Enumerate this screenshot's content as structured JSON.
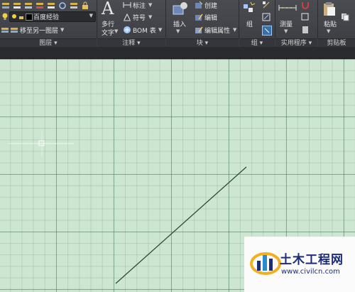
{
  "ribbon": {
    "layers": {
      "current_layer": "百度经验",
      "move_to_layer": "移至另一图层",
      "panel_title": "图层"
    },
    "annotation": {
      "mtext_line1": "多行",
      "mtext_line2": "文字",
      "dimension": "标注",
      "symbol": "符号",
      "bom": "BOM 表",
      "panel_title": "注释"
    },
    "block": {
      "insert": "插入",
      "create": "创建",
      "edit": "编辑",
      "edit_attributes": "编辑属性",
      "panel_title": "块"
    },
    "group": {
      "group": "组",
      "panel_title": "组"
    },
    "utilities": {
      "measure": "测量",
      "panel_title": "实用程序"
    },
    "clipboard": {
      "paste": "粘贴",
      "panel_title": "剪贴板"
    }
  },
  "watermark": {
    "name": "土木工程网",
    "url": "www.civilcn.com"
  },
  "colors": {
    "ribbon_bg": "#3f4146",
    "canvas_bg": "#cde6d2",
    "grid_line": "#5f8f70",
    "drawn_line": "#2f4a3a",
    "watermark_text": "#1c2c7a"
  }
}
